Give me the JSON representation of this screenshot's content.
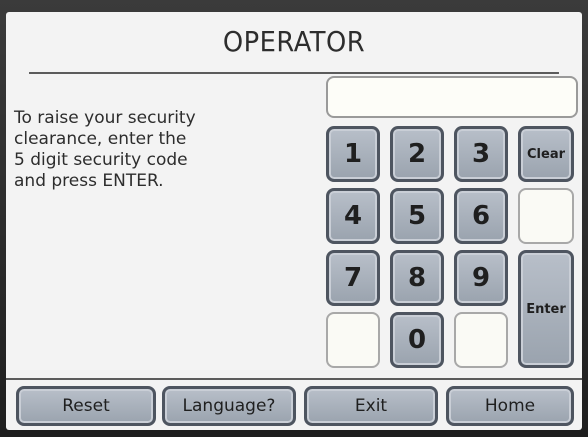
{
  "screen": {
    "title": "OPERATOR",
    "instructions": "To raise your security\nclearance, enter the\n5 digit security code\nand press ENTER."
  },
  "keypad": {
    "digits": [
      "1",
      "2",
      "3",
      "4",
      "5",
      "6",
      "7",
      "8",
      "9",
      "0"
    ],
    "clear_label": "Clear",
    "enter_label": "Enter"
  },
  "code_display": {
    "value": ""
  },
  "navigation": {
    "reset_label": "Reset",
    "language_label": "Language?",
    "exit_label": "Exit",
    "home_label": "Home"
  },
  "colors": {
    "screen_background": "#f3f3f3",
    "key_fill": "#aab1bb",
    "key_border": "#4e5560",
    "text": "#2d2d2d"
  }
}
